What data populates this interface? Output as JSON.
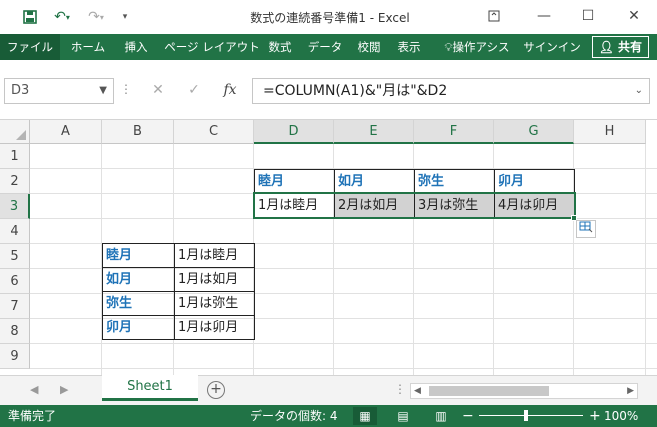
{
  "window": {
    "title": "数式の連続番号準備1 - Excel",
    "minimize_icon": "minimize-icon",
    "maximize_icon": "maximize-icon",
    "close_icon": "close-icon"
  },
  "ribbon": {
    "tabs": [
      "ファイル",
      "ホーム",
      "挿入",
      "ページ レイアウト",
      "数式",
      "データ",
      "校閲",
      "表示",
      "操作アシス",
      "サインイン"
    ],
    "share_label": "共有"
  },
  "formula_bar": {
    "name_box": "D3",
    "formula": "=COLUMN(A1)&\"月は\"&D2"
  },
  "grid": {
    "columns": [
      "A",
      "B",
      "C",
      "D",
      "E",
      "F",
      "G",
      "H"
    ],
    "rows": [
      "1",
      "2",
      "3",
      "4",
      "5",
      "6",
      "7",
      "8",
      "9"
    ],
    "row2": [
      "睦月",
      "如月",
      "弥生",
      "卯月"
    ],
    "row3": [
      "1月は睦月",
      "2月は如月",
      "3月は弥生",
      "4月は卯月"
    ],
    "table2": [
      [
        "睦月",
        "1月は睦月"
      ],
      [
        "如月",
        "1月は如月"
      ],
      [
        "弥生",
        "1月は弥生"
      ],
      [
        "卯月",
        "1月は卯月"
      ]
    ]
  },
  "sheets": {
    "active": "Sheet1"
  },
  "status": {
    "ready": "準備完了",
    "count": "データの個数: 4",
    "zoom": "100%",
    "zoom_minus": "−",
    "zoom_plus": "+"
  }
}
